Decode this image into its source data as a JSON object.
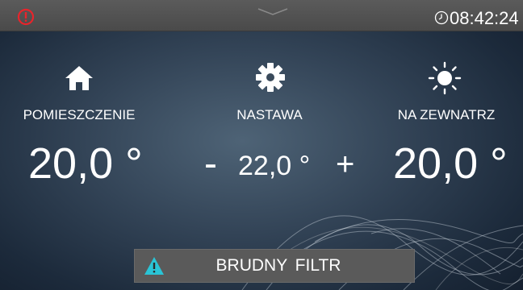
{
  "status_bar": {
    "alert_icon": "alert-circle-icon",
    "alert_color": "#e8242b",
    "clock_icon": "clock-icon",
    "time": "08:42:24"
  },
  "columns": [
    {
      "icon": "home-icon",
      "label": "POMIESZCZENIE",
      "temperature": "20,0 °"
    },
    {
      "icon": "gear-icon",
      "label": "NASTAWA",
      "temperature": "22,0 °",
      "decrement_label": "-",
      "increment_label": "+"
    },
    {
      "icon": "sun-icon",
      "label": "NA ZEWNATRZ",
      "temperature": "20,0 °"
    }
  ],
  "warning": {
    "icon": "warning-triangle-icon",
    "icon_color": "#2ac4d6",
    "text": "BRUDNY  FILTR"
  }
}
